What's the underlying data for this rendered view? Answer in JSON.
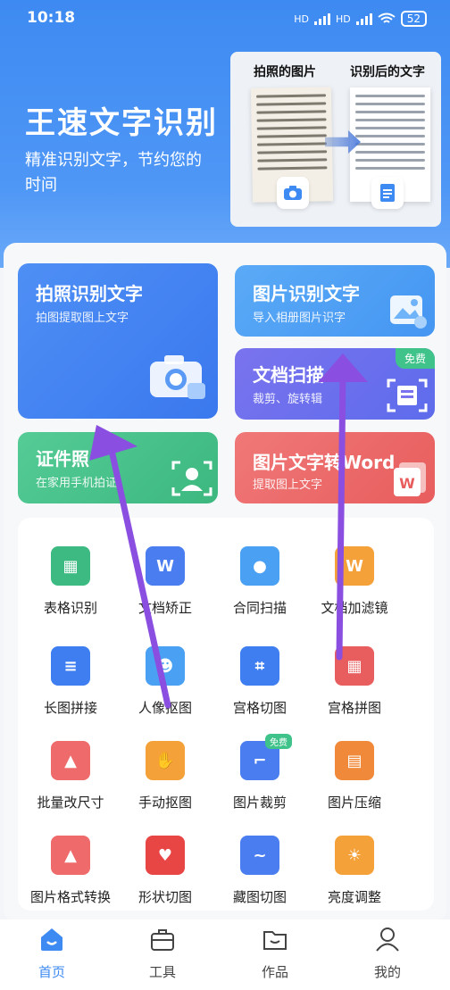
{
  "status_bar": {
    "time": "10:18",
    "network_1": "HD",
    "network_2": "HD",
    "battery": "52"
  },
  "hero": {
    "title": "王速文字识别",
    "subtitle": "精准识别文字，节约您的时间",
    "demo": {
      "left_label": "拍照的图片",
      "right_label": "识别后的文字"
    },
    "bg_color": "#4f97f6"
  },
  "cards": {
    "photo": {
      "title": "拍照识别文字",
      "sub": "拍图提取图上文字"
    },
    "image": {
      "title": "图片识别文字",
      "sub": "导入相册图片识字"
    },
    "scan": {
      "title": "文档扫描",
      "sub": "裁剪、旋转辑",
      "badge": "免费"
    },
    "id": {
      "title": "证件照",
      "sub": "在家用手机拍证"
    },
    "word": {
      "title": "图片文字转Word",
      "sub": "提取图上文字"
    }
  },
  "tools": [
    {
      "label": "表格识别",
      "icon": "table-recognition-icon",
      "color": "#3cba82"
    },
    {
      "label": "文档矫正",
      "icon": "document-correction-icon",
      "color": "#4a7ef0"
    },
    {
      "label": "合同扫描",
      "icon": "contract-scan-icon",
      "color": "#4aa0f2"
    },
    {
      "label": "文档加滤镜",
      "icon": "document-filter-icon",
      "color": "#f5a13a"
    },
    {
      "label": "长图拼接",
      "icon": "long-image-stitch-icon",
      "color": "#3f7ef0"
    },
    {
      "label": "人像抠图",
      "icon": "portrait-cutout-icon",
      "color": "#4aa0f2"
    },
    {
      "label": "宫格切图",
      "icon": "grid-cut-icon",
      "color": "#3f7ef0"
    },
    {
      "label": "宫格拼图",
      "icon": "grid-collage-icon",
      "color": "#e85d5d"
    },
    {
      "label": "批量改尺寸",
      "icon": "batch-resize-icon",
      "color": "#ef6a6a"
    },
    {
      "label": "手动抠图",
      "icon": "manual-cutout-icon",
      "color": "#f5a13a"
    },
    {
      "label": "图片裁剪",
      "icon": "image-crop-icon",
      "color": "#4a7ef0",
      "badge": "免费"
    },
    {
      "label": "图片压缩",
      "icon": "image-compress-icon",
      "color": "#f08a3a"
    },
    {
      "label": "图片格式转换",
      "icon": "format-convert-icon",
      "color": "#ef6a6a"
    },
    {
      "label": "形状切图",
      "icon": "shape-cut-icon",
      "color": "#e84545"
    },
    {
      "label": "藏图切图",
      "icon": "hidden-image-cut-icon",
      "color": "#4a7ef0"
    },
    {
      "label": "亮度调整",
      "icon": "brightness-icon",
      "color": "#f5a13a"
    }
  ],
  "tabbar": [
    {
      "label": "首页",
      "icon": "home-icon",
      "active": true
    },
    {
      "label": "工具",
      "icon": "toolbox-icon",
      "active": false
    },
    {
      "label": "作品",
      "icon": "folder-icon",
      "active": false
    },
    {
      "label": "我的",
      "icon": "profile-icon",
      "active": false
    }
  ],
  "accent_color": "#3d8af2",
  "annotation_arrow_color": "#8a4fe0"
}
